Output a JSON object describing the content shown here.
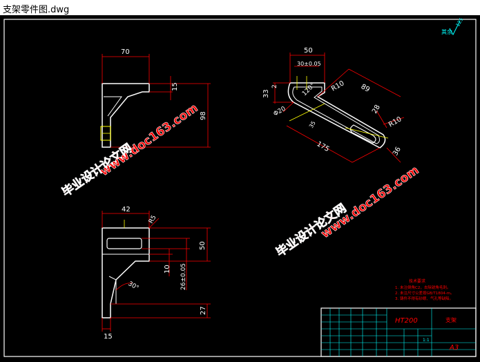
{
  "window": {
    "title": "支架零件图.dwg"
  },
  "roughness": {
    "label": "其余",
    "value": "125"
  },
  "dims": {
    "top_view": {
      "w70": "70",
      "h15": "15",
      "h98": "98"
    },
    "side_view": {
      "w50": "50",
      "w30": "30±0.05",
      "r10a": "R10",
      "d89": "89",
      "a120": "120°",
      "h33": "33",
      "h2": "2",
      "d20": "Φ20",
      "h35": "35",
      "d175": "175",
      "r10b": "R10",
      "d28": "28",
      "d36": "36"
    },
    "front_view": {
      "w42": "42",
      "r5": "R5",
      "h50": "50",
      "h10": "10",
      "h26": "26±0.05",
      "a30": "30°",
      "h27": "27",
      "w15": "15"
    }
  },
  "watermark": {
    "line1": "毕业设计论文网",
    "line2": "www.doc163.com"
  },
  "notes": {
    "title": "技术要求",
    "items": [
      "1. 未注倒角C2，去除锐角毛刺。",
      "2. 未注尺寸公差按GB/T1804-m。",
      "3. 铸件不得有砂眼、气孔等缺陷。"
    ]
  },
  "title_block": {
    "material": "HT200",
    "part_name": "支架",
    "sheet_size": "A3",
    "scale": "1:1"
  }
}
